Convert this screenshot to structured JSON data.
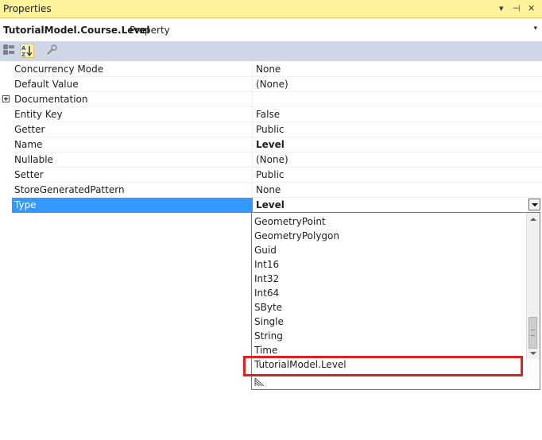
{
  "window": {
    "title": "Properties"
  },
  "title_buttons": {
    "dropdown": "▾",
    "pin": "⊣",
    "close": "✕"
  },
  "object_selector": {
    "name": "TutorialModel.Course.Level",
    "type": "Property",
    "arrow": "▾"
  },
  "toolbar": {
    "buttons": [
      {
        "name": "categorized-icon",
        "active": false
      },
      {
        "name": "alphabetical-icon",
        "active": true
      },
      {
        "name": "property-pages-icon",
        "active": false
      }
    ]
  },
  "properties": [
    {
      "name": "Concurrency Mode",
      "value": "None"
    },
    {
      "name": "Default Value",
      "value": "(None)"
    },
    {
      "name": "Documentation",
      "value": "",
      "expandable": true
    },
    {
      "name": "Entity Key",
      "value": "False"
    },
    {
      "name": "Getter",
      "value": "Public"
    },
    {
      "name": "Name",
      "value": "Level",
      "bold": true
    },
    {
      "name": "Nullable",
      "value": "(None)"
    },
    {
      "name": "Setter",
      "value": "Public"
    },
    {
      "name": "StoreGeneratedPattern",
      "value": "None"
    },
    {
      "name": "Type",
      "value": "Level",
      "bold": true,
      "selected": true
    }
  ],
  "type_dropdown": {
    "options": [
      "GeometryPoint",
      "GeometryPolygon",
      "Guid",
      "Int16",
      "Int32",
      "Int64",
      "SByte",
      "Single",
      "String",
      "Time",
      "TutorialModel.Level"
    ],
    "highlighted": "TutorialModel.Level"
  },
  "colors": {
    "title_bar": "#fff29d",
    "toolbar": "#cfd6e5",
    "selection": "#3399ff",
    "highlight_box": "#e02020"
  }
}
